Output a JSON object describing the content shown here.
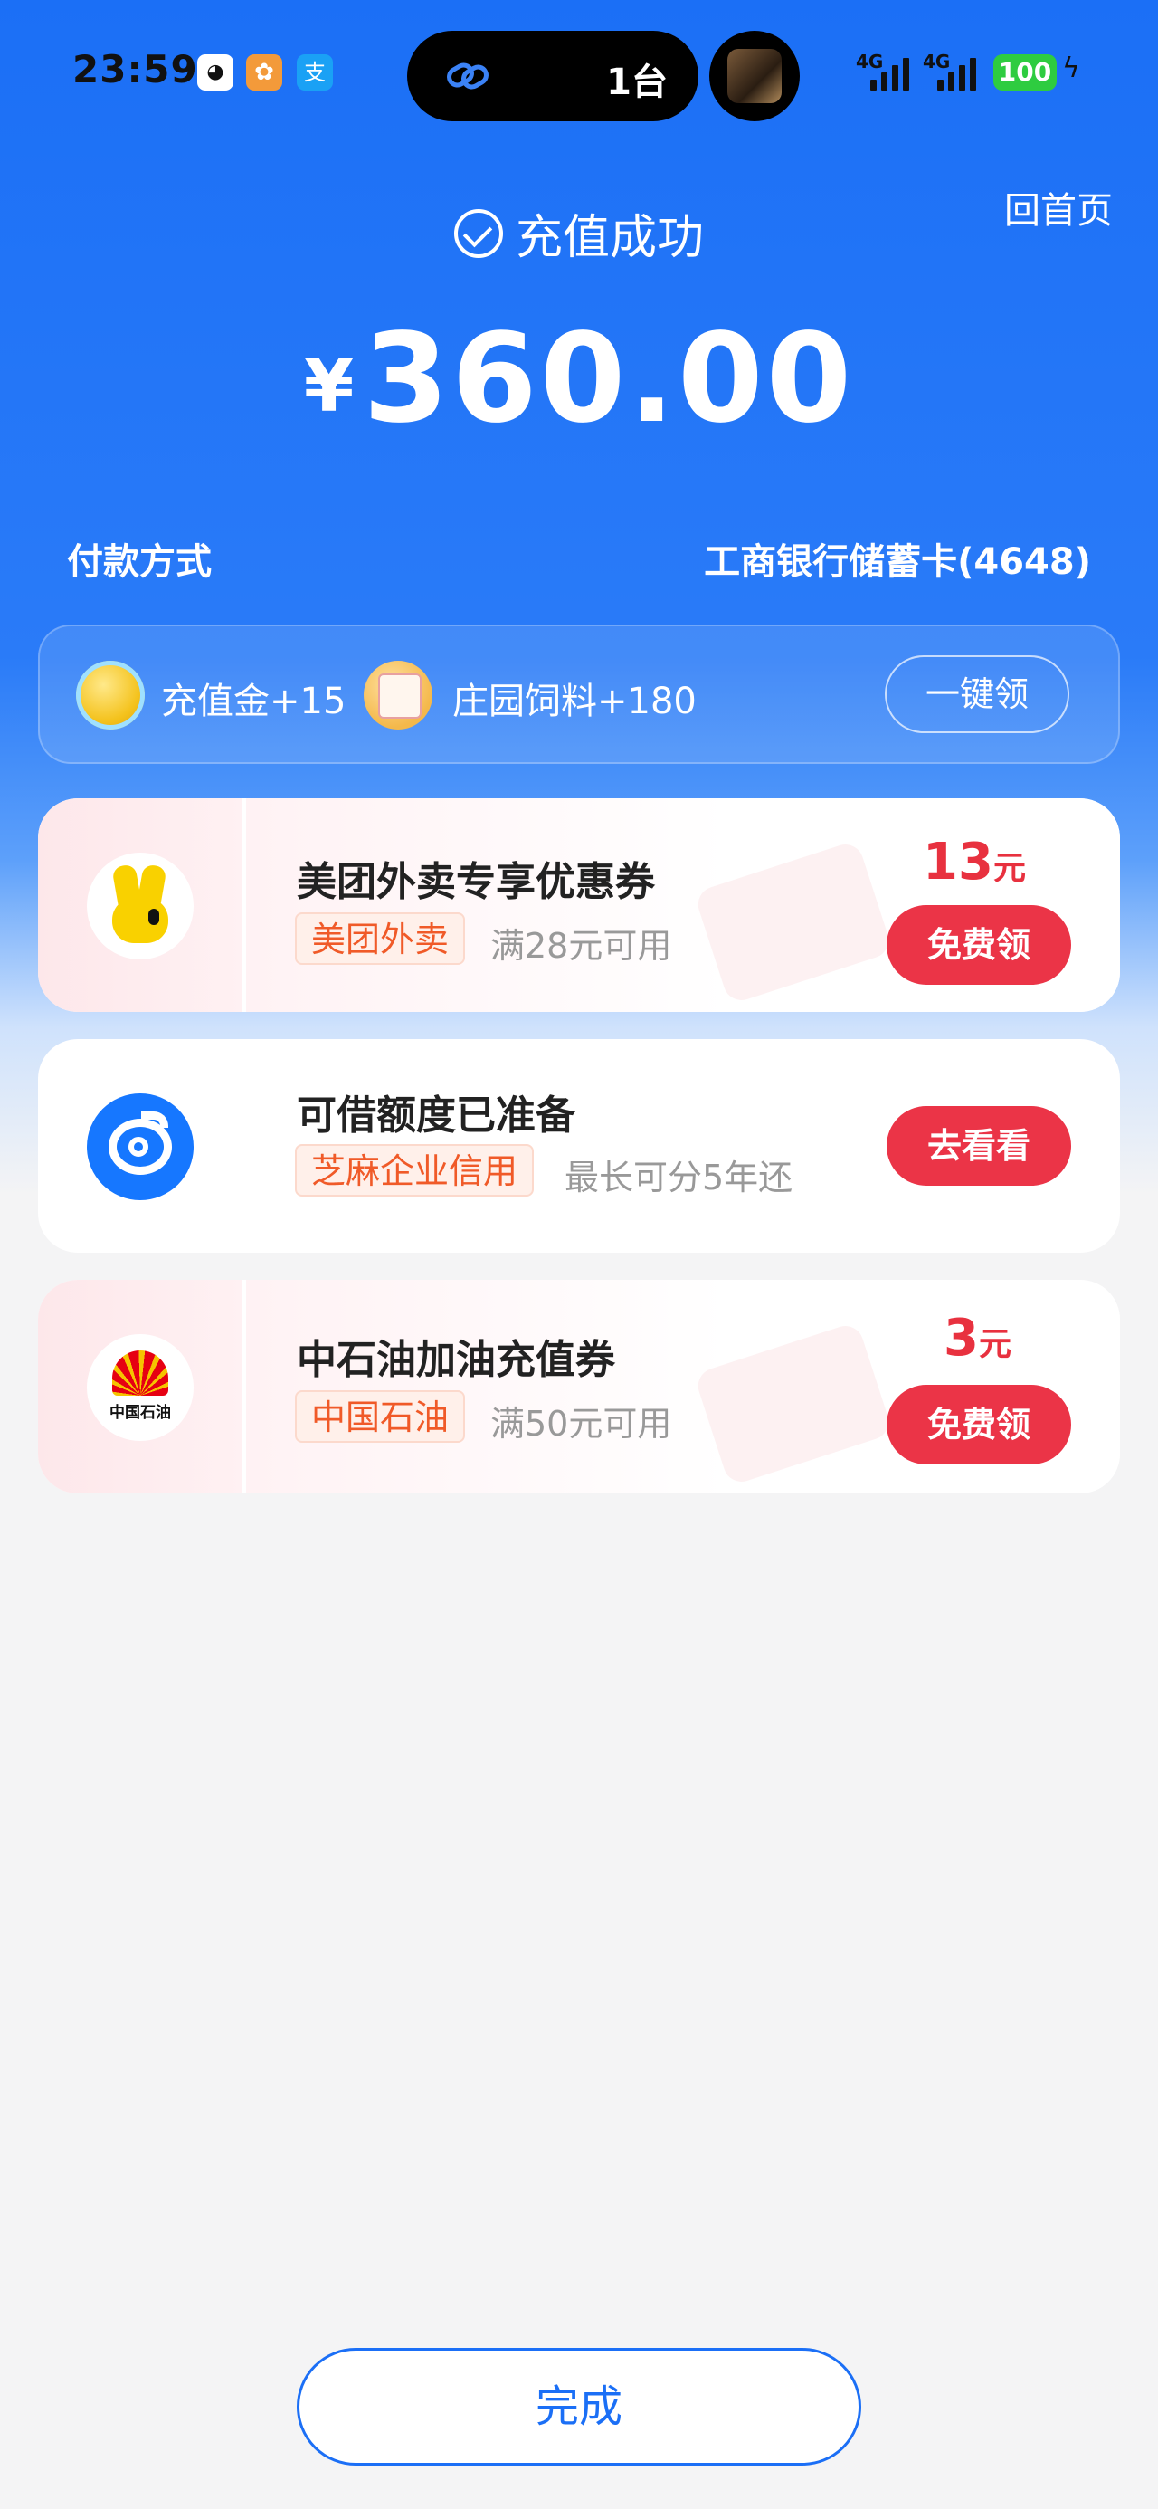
{
  "status_bar": {
    "time": "23:59",
    "island_count": "1台",
    "signal_1": "4G",
    "signal_2": "4G",
    "battery": "100",
    "app_icons": [
      "qq-icon",
      "taobao-flying-pig-icon",
      "alipay-icon"
    ]
  },
  "header": {
    "home_link": "回首页",
    "success_title": "充值成功",
    "currency": "¥",
    "amount": "360.00"
  },
  "payment": {
    "label": "付款方式",
    "value": "工商银行储蓄卡(4648)"
  },
  "rewards": {
    "items": [
      {
        "label": "充值金+15",
        "icon": "gold-coin-icon"
      },
      {
        "label": "庄园饲料+180",
        "icon": "feed-bag-icon"
      }
    ],
    "claim_all": "一键领"
  },
  "offers": [
    {
      "title": "美团外卖专享优惠券",
      "tag": "美团外卖",
      "condition": "满28元可用",
      "price": "13",
      "unit": "元",
      "button": "免费领",
      "icon": "meituan-kangaroo-icon"
    },
    {
      "title": "可借额度已准备",
      "tag": "芝麻企业信用",
      "condition": "最长可分5年还",
      "button": "去看看",
      "icon": "zhima-credit-icon"
    },
    {
      "title": "中石油加油充值券",
      "tag": "中国石油",
      "condition": "满50元可用",
      "price": "3",
      "unit": "元",
      "button": "免费领",
      "icon": "petrochina-logo-icon",
      "logo_text": "中国石油"
    }
  ],
  "footer": {
    "done_button": "完成"
  },
  "colors": {
    "primary_blue": "#1b6ff6",
    "accent_red": "#eb3447",
    "tag_orange": "#f05a28"
  }
}
